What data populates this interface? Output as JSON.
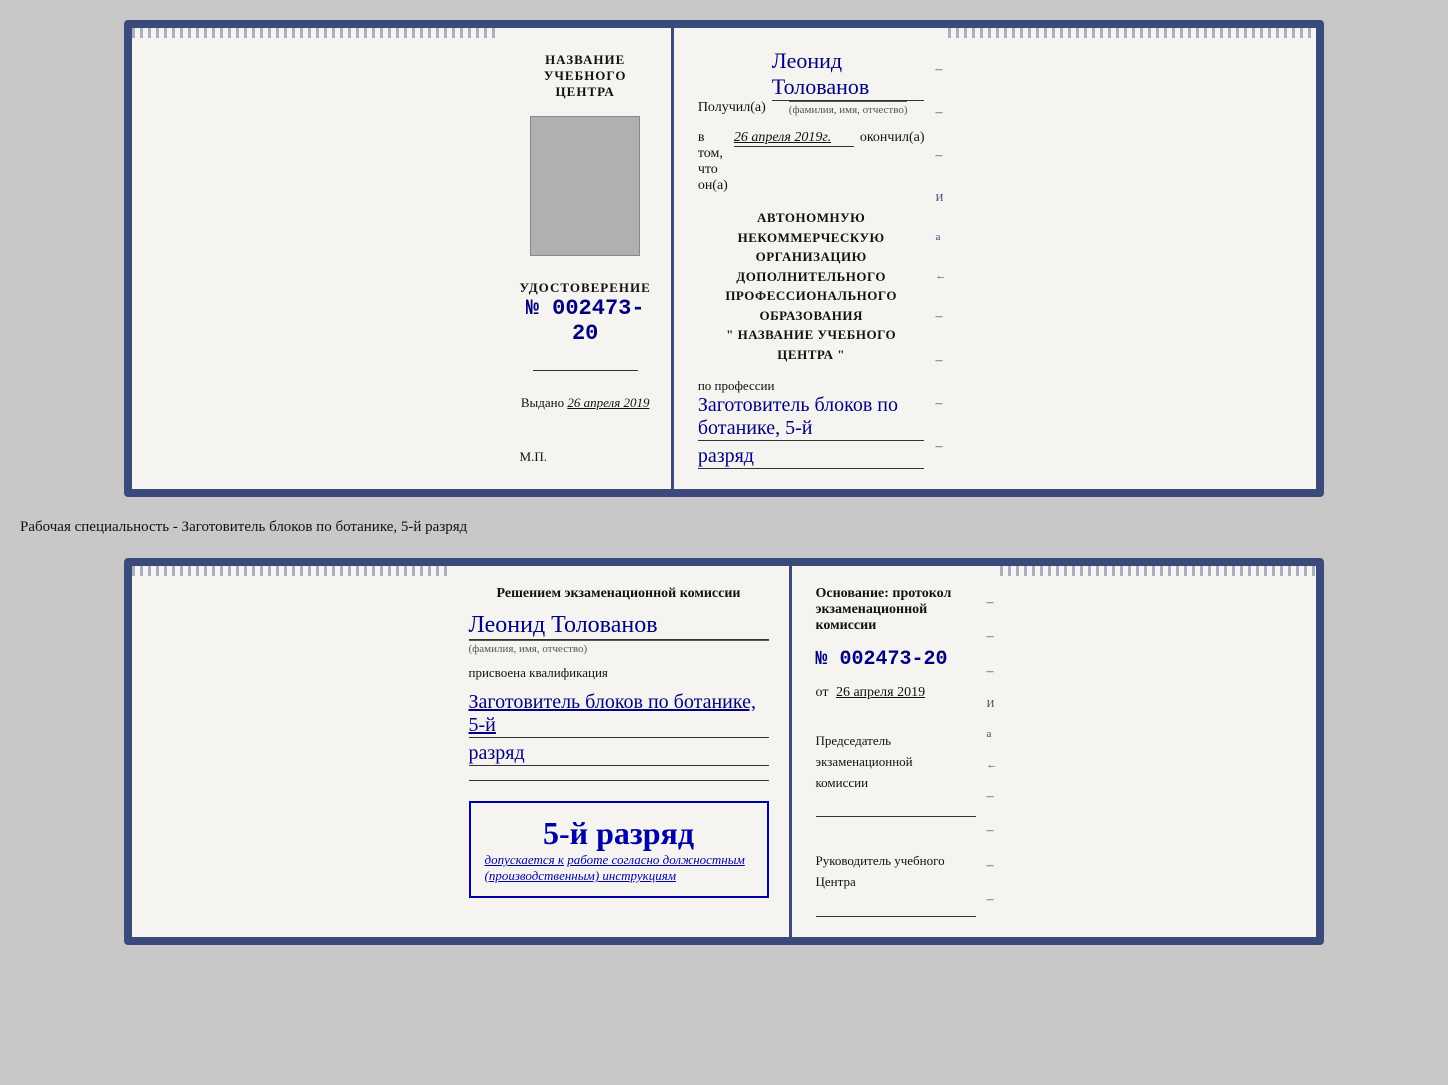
{
  "doc1": {
    "left": {
      "title": "НАЗВАНИЕ УЧЕБНОГО ЦЕНТРА",
      "cert_label": "УДОСТОВЕРЕНИЕ",
      "cert_number": "№ 002473-20",
      "issued_prefix": "Выдано",
      "issued_date": "26 апреля 2019",
      "mp_label": "М.П."
    },
    "right": {
      "received_prefix": "Получил(а)",
      "recipient_name": "Леонид Толованов",
      "recipient_caption": "(фамилия, имя, отчество)",
      "date_prefix": "в том, что он(а)",
      "date_value": "26 апреля 2019г.",
      "date_suffix": "окончил(а)",
      "org_line1": "АВТОНОМНУЮ НЕКОММЕРЧЕСКУЮ ОРГАНИЗАЦИЮ",
      "org_line2": "ДОПОЛНИТЕЛЬНОГО ПРОФЕССИОНАЛЬНОГО ОБРАЗОВАНИЯ",
      "org_line3": "\"  НАЗВАНИЕ УЧЕБНОГО ЦЕНТРА  \"",
      "profession_prefix": "по профессии",
      "profession_value": "Заготовитель блоков по ботанике, 5-й",
      "razryad_value": "разряд"
    }
  },
  "separator": {
    "text": "Рабочая специальность - Заготовитель блоков по ботанике, 5-й разряд"
  },
  "doc2": {
    "left": {
      "decision_text": "Решением экзаменационной комиссии",
      "person_name": "Леонид Толованов",
      "person_caption": "(фамилия, имя, отчество)",
      "assigned_text": "присвоена квалификация",
      "profession_value": "Заготовитель блоков по ботанике, 5-й",
      "razryad_value": "разряд",
      "stamp_grade": "5-й разряд",
      "stamp_text_prefix": "допускается к",
      "stamp_text_link": "работе согласно должностным",
      "stamp_text_suffix": "(производственным) инструкциям"
    },
    "right": {
      "basis_text": "Основание: протокол экзаменационной комиссии",
      "protocol_number": "№  002473-20",
      "ot_prefix": "от",
      "ot_date": "26 апреля 2019",
      "chairman_line1": "Председатель экзаменационной",
      "chairman_line2": "комиссии",
      "head_line1": "Руководитель учебного",
      "head_line2": "Центра"
    }
  }
}
